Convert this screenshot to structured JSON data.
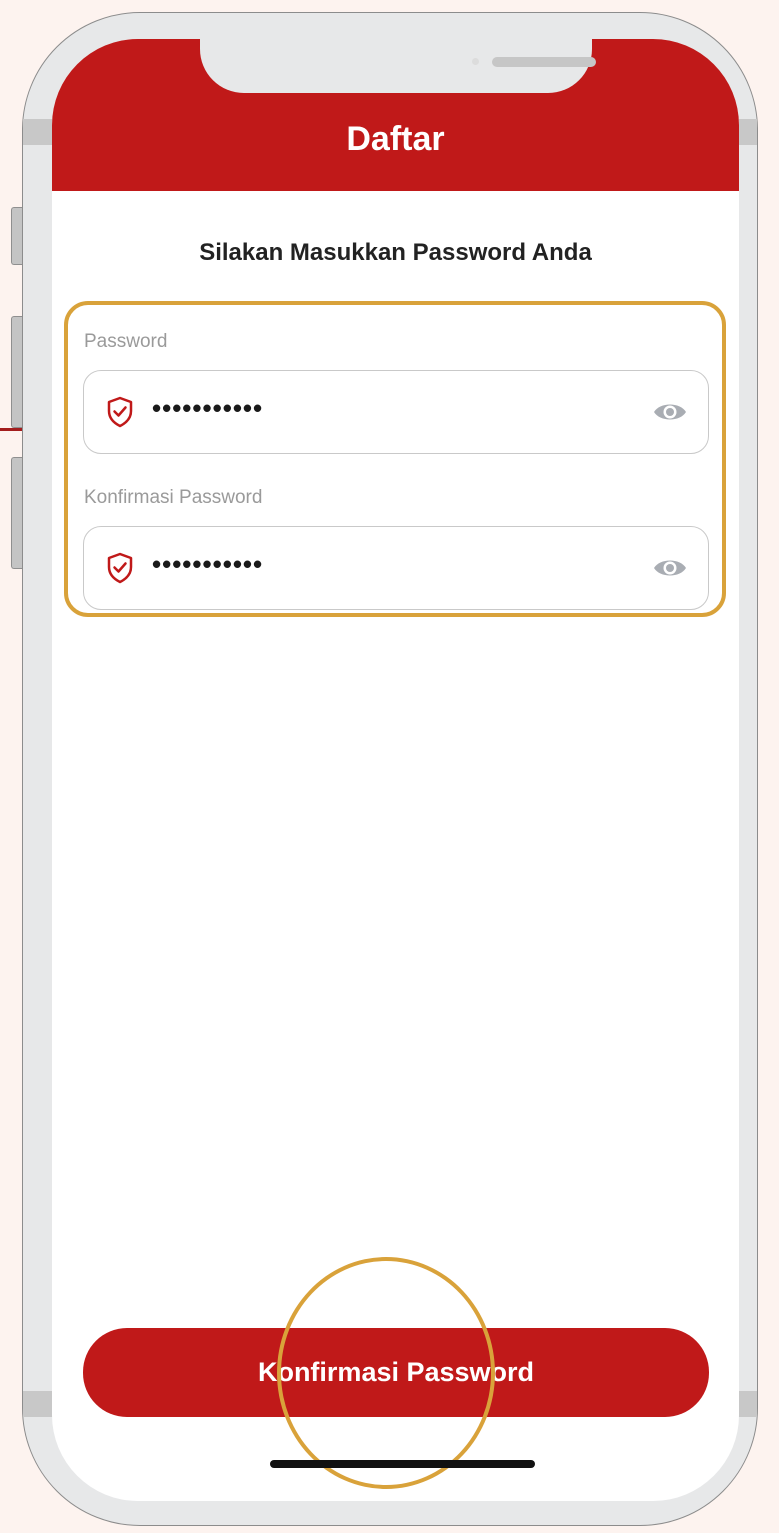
{
  "header": {
    "title": "Daftar"
  },
  "page": {
    "subtitle": "Silakan Masukkan Password Anda"
  },
  "form": {
    "password": {
      "label": "Password",
      "value": "•••••••••••",
      "icon": "shield-check-icon",
      "toggle_icon": "eye-icon"
    },
    "confirm_password": {
      "label": "Konfirmasi Password",
      "value": "•••••••••••",
      "icon": "shield-check-icon",
      "toggle_icon": "eye-icon"
    }
  },
  "actions": {
    "confirm_label": "Konfirmasi Password"
  },
  "colors": {
    "primary": "#c01919",
    "highlight": "#d9a23a",
    "background": "#fdf3ef"
  }
}
